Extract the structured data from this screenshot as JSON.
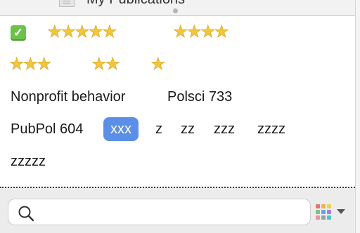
{
  "header": {
    "title": "My Publications"
  },
  "tags": {
    "check": "✓",
    "star5": "★★★★★",
    "star4": "★★★★",
    "star3": "★★★",
    "star2": "★★",
    "star1": "★",
    "nonprofit": "Nonprofit behavior",
    "polsci": "Polsci 733",
    "pubpol": "PubPol 604",
    "xxx": "xxx",
    "z": "z",
    "zz": "zz",
    "zzz": "zzz",
    "zzzz": "zzzz",
    "zzzzz": "zzzzz"
  },
  "search": {
    "placeholder": "",
    "value": ""
  },
  "icons": {
    "check": "check-icon",
    "search": "search-icon",
    "grid": "grid-icon",
    "caret": "chevron-down-icon",
    "doc": "document-icon"
  },
  "colors": {
    "selected_tag": "#5b8fe6",
    "star": "#f2c53d",
    "check": "#6cc24a"
  }
}
